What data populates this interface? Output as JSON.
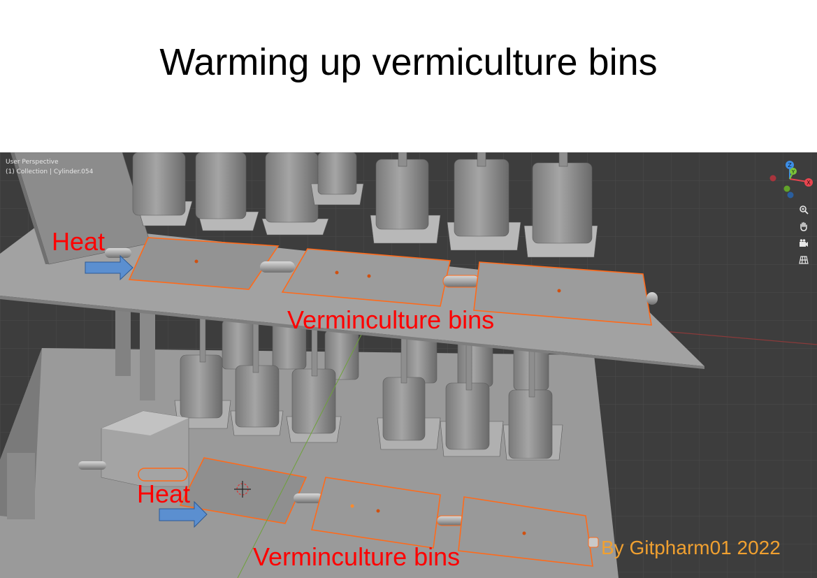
{
  "title": "Warming up vermiculture bins",
  "viewport": {
    "perspective_label": "User Perspective",
    "collection_label": "(1) Collection | Cylinder.054"
  },
  "labels": {
    "heat_top": "Heat",
    "heat_bottom": "Heat",
    "bins_top": "Verminculture bins",
    "bins_bottom": "Verminculture bins",
    "credit": "By Gitpharm01 2022"
  },
  "gizmo": {
    "axes": [
      "Z",
      "Y",
      "X"
    ],
    "tools": [
      "zoom-icon",
      "hand-pan-icon",
      "camera-icon",
      "grid-view-icon"
    ]
  },
  "colors": {
    "label_red": "#ff0000",
    "credit_orange": "#f0a030",
    "selection_orange": "#ff6a1a",
    "arrow_blue": "#5b8fd0",
    "axis_x": "#e8454f",
    "axis_y": "#7bc43a",
    "axis_z": "#3d8ee6"
  }
}
